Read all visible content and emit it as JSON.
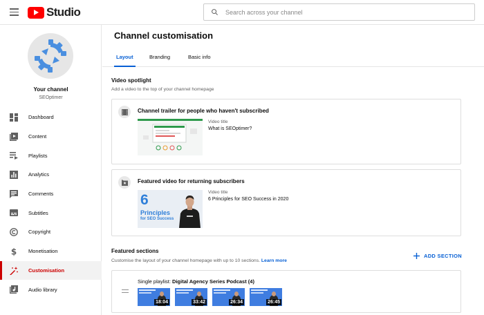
{
  "header": {
    "logo_text": "Studio",
    "search_placeholder": "Search across your channel"
  },
  "channel": {
    "title": "Your channel",
    "name": "SEOptimer"
  },
  "sidebar": {
    "items": [
      {
        "label": "Dashboard",
        "icon": "dashboard-icon"
      },
      {
        "label": "Content",
        "icon": "content-icon"
      },
      {
        "label": "Playlists",
        "icon": "playlists-icon"
      },
      {
        "label": "Analytics",
        "icon": "analytics-icon"
      },
      {
        "label": "Comments",
        "icon": "comments-icon"
      },
      {
        "label": "Subtitles",
        "icon": "subtitles-icon"
      },
      {
        "label": "Copyright",
        "icon": "copyright-icon"
      },
      {
        "label": "Monetisation",
        "icon": "monetisation-icon"
      },
      {
        "label": "Customisation",
        "icon": "customisation-icon",
        "active": true
      },
      {
        "label": "Audio library",
        "icon": "audio-library-icon"
      }
    ]
  },
  "main": {
    "title": "Channel customisation",
    "tabs": [
      {
        "label": "Layout",
        "active": true
      },
      {
        "label": "Branding"
      },
      {
        "label": "Basic info"
      }
    ],
    "spotlight": {
      "title": "Video spotlight",
      "desc": "Add a video to the top of your channel homepage",
      "trailer": {
        "title": "Channel trailer for people who haven't subscribed",
        "video_label": "Video title",
        "video_title": "What is SEOptimer?"
      },
      "featured": {
        "title": "Featured video for returning subscribers",
        "video_label": "Video title",
        "video_title": "6 Principles for SEO Success in 2020",
        "thumb_number": "6",
        "thumb_word": "Principles",
        "thumb_sub": "for SEO Success"
      }
    },
    "featured_sections": {
      "title": "Featured sections",
      "desc": "Customise the layout of your channel homepage with up to 10 sections.",
      "learn_more": "Learn more",
      "add_label": "ADD SECTION",
      "playlist": {
        "prefix": "Single playlist:",
        "name": "Digital Agency Series Podcast (4)",
        "durations": [
          "18:04",
          "33:42",
          "26:34",
          "26:45"
        ]
      }
    }
  },
  "colors": {
    "accent": "#065fd4",
    "active_nav": "#cc0000",
    "brand": "#ff0000"
  }
}
